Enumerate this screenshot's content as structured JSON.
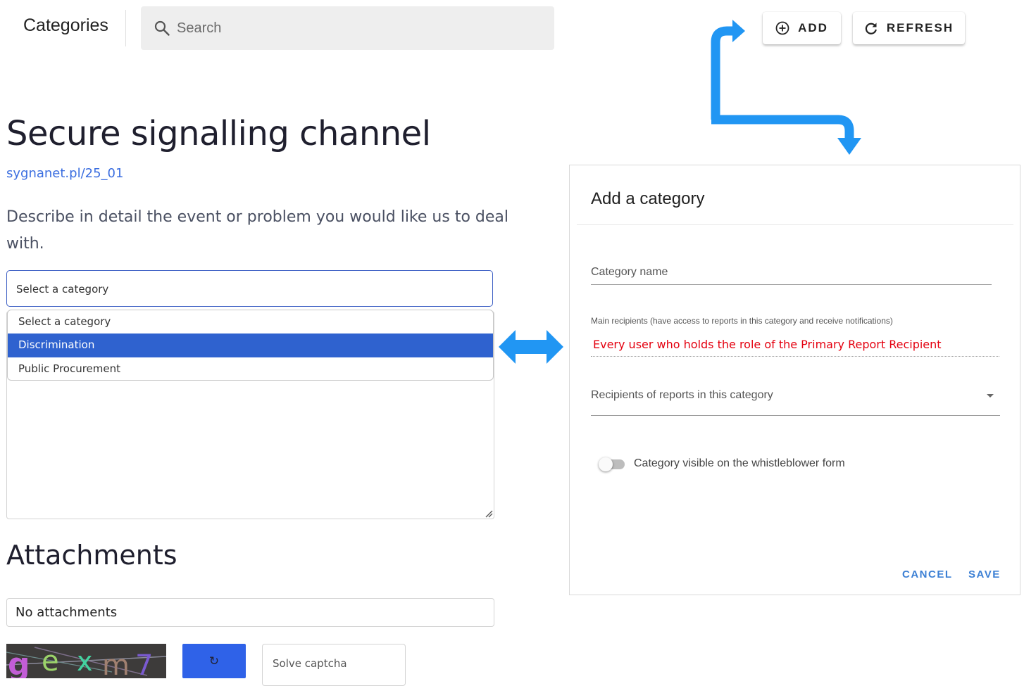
{
  "topbar": {
    "title": "Categories",
    "search_placeholder": "Search",
    "add_label": "ADD",
    "refresh_label": "REFRESH"
  },
  "form": {
    "title": "Secure signalling channel",
    "link": "sygnanet.pl/25_01",
    "description": "Describe in detail the event or problem you would like us to deal with.",
    "select_value": "Select a category",
    "dropdown_options": [
      "Select a category",
      "Discrimination",
      "Public Procurement"
    ],
    "dropdown_selected": "Discrimination",
    "attachments_title": "Attachments",
    "attachments_value": "No attachments",
    "captcha_text": "gexm7",
    "captcha_refresh_symbol": "↻",
    "captcha_placeholder": "Solve captcha"
  },
  "dialog": {
    "title": "Add a category",
    "category_name_label": "Category name",
    "main_recipients_label": "Main recipients (have access to reports in this category and receive notifications)",
    "main_recipients_value": "Every user who holds the role of the Primary Report Recipient",
    "recipients_label": "Recipients of reports in this category",
    "visible_toggle_label": "Category visible on the whistleblower form",
    "visible_toggle_on": false,
    "cancel_label": "CANCEL",
    "save_label": "SAVE"
  },
  "colors": {
    "accent_blue": "#2196F3",
    "dialog_button": "#3b7fd4",
    "dropdown_selected": "#2f62cf",
    "annotation_red": "#e4000f"
  },
  "icons": {
    "search": "search-icon",
    "add": "add-circle-icon",
    "refresh": "refresh-icon",
    "dropdown_caret": "caret-down-icon",
    "connector_arrow": "bent-arrow-icon",
    "double_arrow": "double-arrow-icon"
  }
}
